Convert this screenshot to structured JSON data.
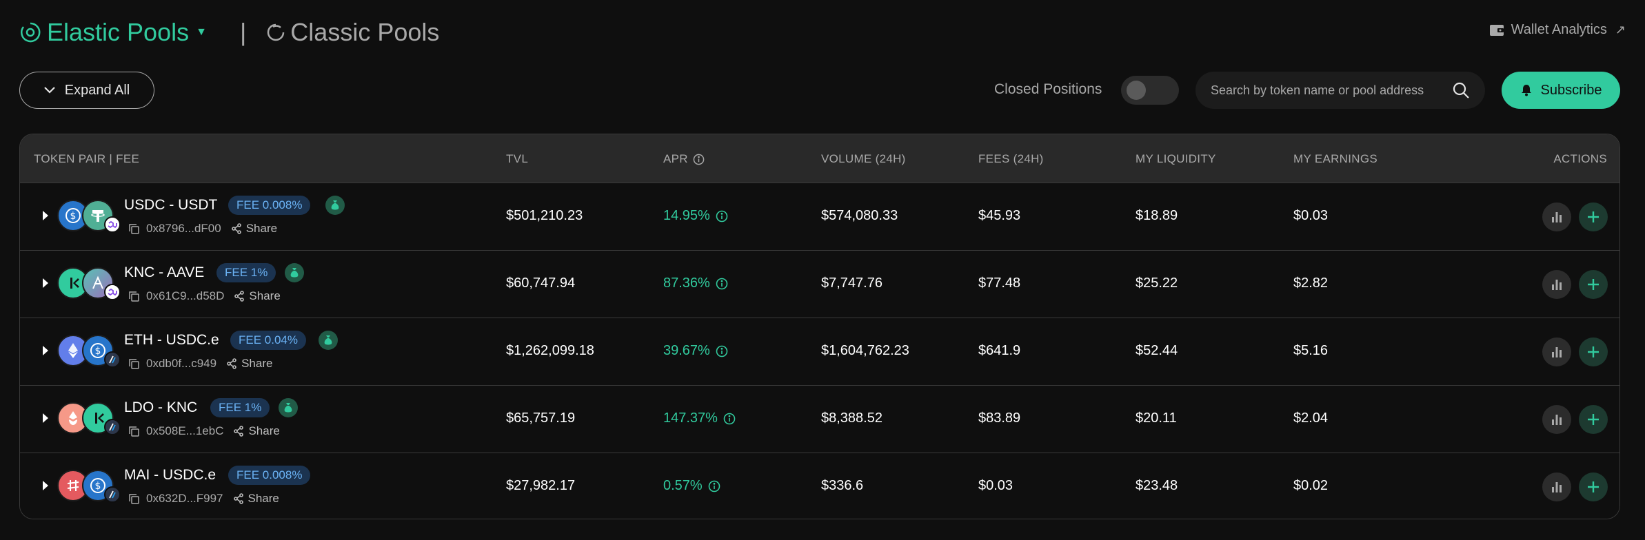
{
  "header": {
    "elastic_label": "Elastic Pools",
    "separator": "|",
    "classic_label": "Classic Pools",
    "wallet_label": "Wallet Analytics",
    "wallet_arrow": "↗"
  },
  "controls": {
    "expand_label": "Expand All",
    "closed_positions_label": "Closed Positions",
    "closed_positions_on": false,
    "search_placeholder": "Search by token name or pool address",
    "subscribe_label": "Subscribe"
  },
  "columns": {
    "pair": "TOKEN PAIR | FEE",
    "tvl": "TVL",
    "apr": "APR",
    "volume": "VOLUME (24H)",
    "fees": "FEES (24H)",
    "liquidity": "MY LIQUIDITY",
    "earnings": "MY EARNINGS",
    "actions": "ACTIONS"
  },
  "colors": {
    "accent": "#31cb9e",
    "fee_badge_bg": "#1b3350",
    "fee_badge_text": "#6bb3f5",
    "background": "#0f0f0f",
    "header_bg": "#292929"
  },
  "rows": [
    {
      "pair": "USDC - USDT",
      "fee": "FEE 0.008%",
      "address": "0x8796...dF00",
      "share": "Share",
      "tvl": "$501,210.23",
      "apr": "14.95%",
      "volume": "$574,080.33",
      "fees": "$45.93",
      "liquidity": "$18.89",
      "earnings": "$0.03",
      "token_icons": [
        "usdc-icon",
        "usdt-icon"
      ],
      "chain_icon": "polygon-icon"
    },
    {
      "pair": "KNC - AAVE",
      "fee": "FEE 1%",
      "address": "0x61C9...d58D",
      "share": "Share",
      "tvl": "$60,747.94",
      "apr": "87.36%",
      "volume": "$7,747.76",
      "fees": "$77.48",
      "liquidity": "$25.22",
      "earnings": "$2.82",
      "token_icons": [
        "knc-icon",
        "aave-icon"
      ],
      "chain_icon": "polygon-icon"
    },
    {
      "pair": "ETH - USDC.e",
      "fee": "FEE 0.04%",
      "address": "0xdb0f...c949",
      "share": "Share",
      "tvl": "$1,262,099.18",
      "apr": "39.67%",
      "volume": "$1,604,762.23",
      "fees": "$641.9",
      "liquidity": "$52.44",
      "earnings": "$5.16",
      "token_icons": [
        "eth-icon",
        "usdc-icon"
      ],
      "chain_icon": "arbitrum-icon"
    },
    {
      "pair": "LDO - KNC",
      "fee": "FEE 1%",
      "address": "0x508E...1ebC",
      "share": "Share",
      "tvl": "$65,757.19",
      "apr": "147.37%",
      "volume": "$8,388.52",
      "fees": "$83.89",
      "liquidity": "$20.11",
      "earnings": "$2.04",
      "token_icons": [
        "ldo-icon",
        "knc-icon"
      ],
      "chain_icon": "arbitrum-icon"
    },
    {
      "pair": "MAI - USDC.e",
      "fee": "FEE 0.008%",
      "address": "0x632D...F997",
      "share": "Share",
      "tvl": "$27,982.17",
      "apr": "0.57%",
      "volume": "$336.6",
      "fees": "$0.03",
      "liquidity": "$23.48",
      "earnings": "$0.02",
      "token_icons": [
        "mai-icon",
        "usdc-icon"
      ],
      "chain_icon": "arbitrum-icon"
    }
  ]
}
